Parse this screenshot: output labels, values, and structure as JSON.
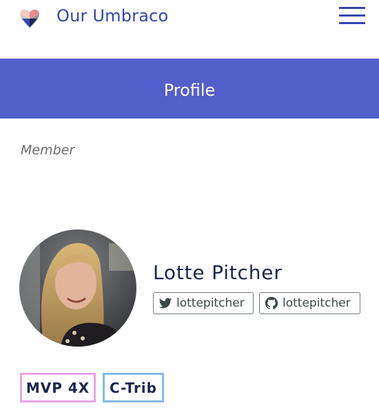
{
  "header": {
    "brand": "Our Umbraco",
    "logo_icon": "heart-icon",
    "menu_icon": "hamburger-icon"
  },
  "banner": {
    "title": "Profile",
    "color": "#535fca"
  },
  "profile": {
    "role": "Member",
    "name": "Lotte Pitcher",
    "twitter": {
      "icon": "twitter-icon",
      "handle": "lottepitcher"
    },
    "github": {
      "icon": "github-icon",
      "handle": "lottepitcher"
    }
  },
  "badges": [
    {
      "label": "MVP 4X",
      "color": "#e7a4e6"
    },
    {
      "label": "C-Trib",
      "color": "#85b9ea"
    }
  ]
}
